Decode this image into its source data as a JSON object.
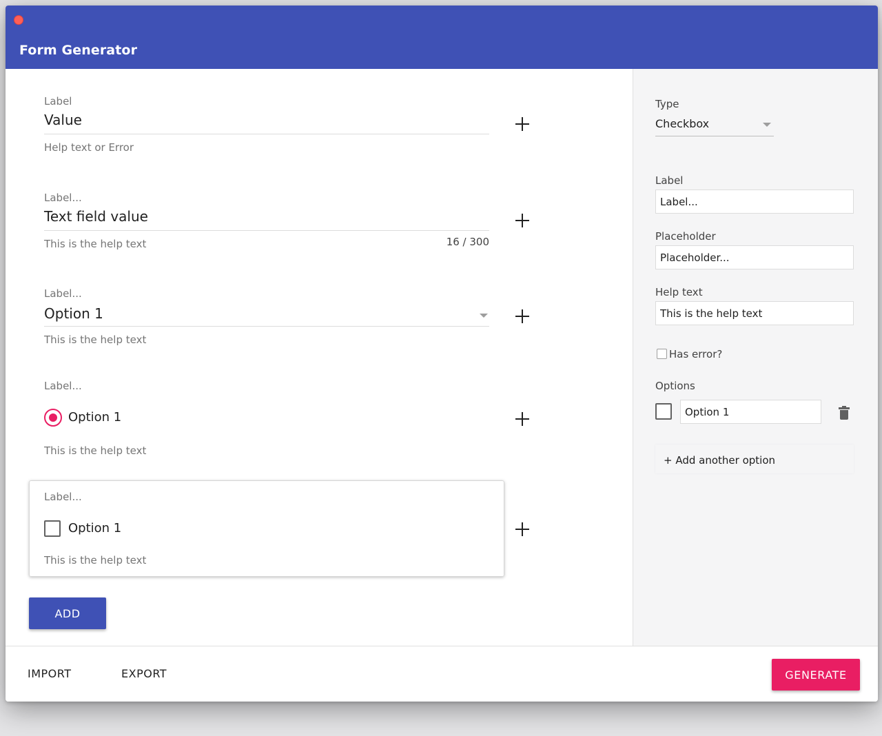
{
  "window": {
    "title": "Form Generator"
  },
  "fields": [
    {
      "label": "Label",
      "value": "Value",
      "help": "Help text or Error"
    },
    {
      "label": "Label...",
      "value": "Text field value",
      "help": "This is the help text",
      "counter": "16 / 300"
    },
    {
      "label": "Label...",
      "value": "Option 1",
      "help": "This is the help text"
    },
    {
      "label": "Label...",
      "option": "Option 1",
      "help": "This is the help text"
    },
    {
      "label": "Label...",
      "option": "Option 1",
      "help": "This is the help text"
    }
  ],
  "add_button": "ADD",
  "sidebar": {
    "type_label": "Type",
    "type_value": "Checkbox",
    "label_label": "Label",
    "label_value": "Label...",
    "placeholder_label": "Placeholder",
    "placeholder_value": "Placeholder...",
    "help_label": "Help text",
    "help_value": "This is the help text",
    "has_error_label": "Has error?",
    "options_label": "Options",
    "option_value": "Option 1",
    "add_option": "+ Add another option"
  },
  "footer": {
    "import": "IMPORT",
    "export": "EXPORT",
    "generate": "GENERATE"
  },
  "colors": {
    "primary": "#3f51b5",
    "accent": "#e91e63"
  }
}
